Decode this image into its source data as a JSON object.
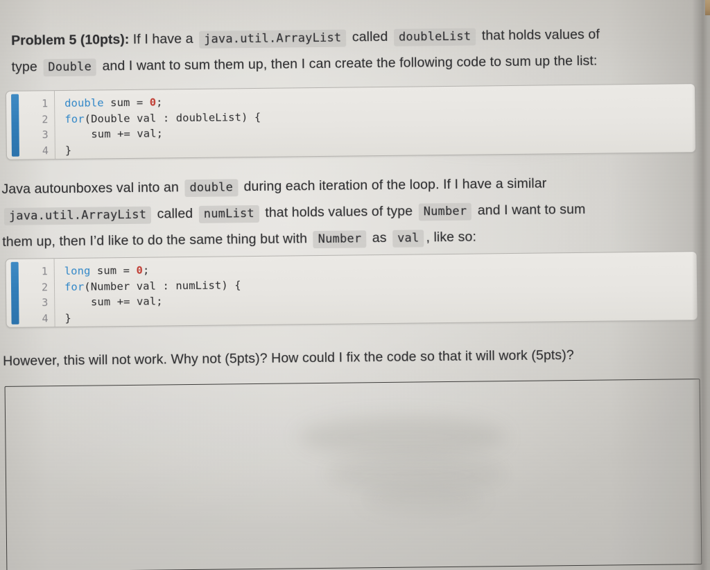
{
  "document": {
    "type": "photographed-worksheet",
    "problem_heading": "Problem 5 (10pts):",
    "paragraph1": {
      "seg1": "If I have a",
      "code1": "java.util.ArrayList",
      "seg2": "called",
      "code2": "doubleList",
      "seg3": "that holds values of",
      "line2_seg1": "type",
      "line2_code1": "Double",
      "line2_seg2": "and I want to sum them up, then I can create the following code to sum up the list:"
    },
    "code_block_1": {
      "line_numbers": [
        "1",
        "2",
        "3",
        "4"
      ],
      "lines": [
        "double sum = 0;",
        "for(Double val : doubleList) {",
        "    sum += val;",
        "}"
      ],
      "accent_color": "#2f7cb8",
      "background_color": "#e9e7e3"
    },
    "paragraph2": {
      "line1_seg1": "Java autounboxes val into an",
      "line1_code1": "double",
      "line1_seg2": "during each iteration of the loop. If I have a similar",
      "line2_code1": "java.util.ArrayList",
      "line2_seg1": "called",
      "line2_code2": "numList",
      "line2_seg2": "that holds values of type",
      "line2_code3": "Number",
      "line2_seg3": "and I want to sum",
      "line3_seg1": "them up, then I’d like to do the same thing but with",
      "line3_code1": "Number",
      "line3_seg2": "as",
      "line3_code2": "val",
      "line3_seg3": ", like so:"
    },
    "code_block_2": {
      "line_numbers": [
        "1",
        "2",
        "3",
        "4"
      ],
      "lines": [
        "long sum = 0;",
        "for(Number val : numList) {",
        "    sum += val;",
        "}"
      ],
      "accent_color": "#2f7cb8",
      "background_color": "#e9e7e3"
    },
    "paragraph3": {
      "text": "However, this will not work. Why not (5pts)? How could I fix the code so that it will work (5pts)?"
    },
    "answer_box": {
      "content": "",
      "border_color": "#3b3a38"
    }
  }
}
